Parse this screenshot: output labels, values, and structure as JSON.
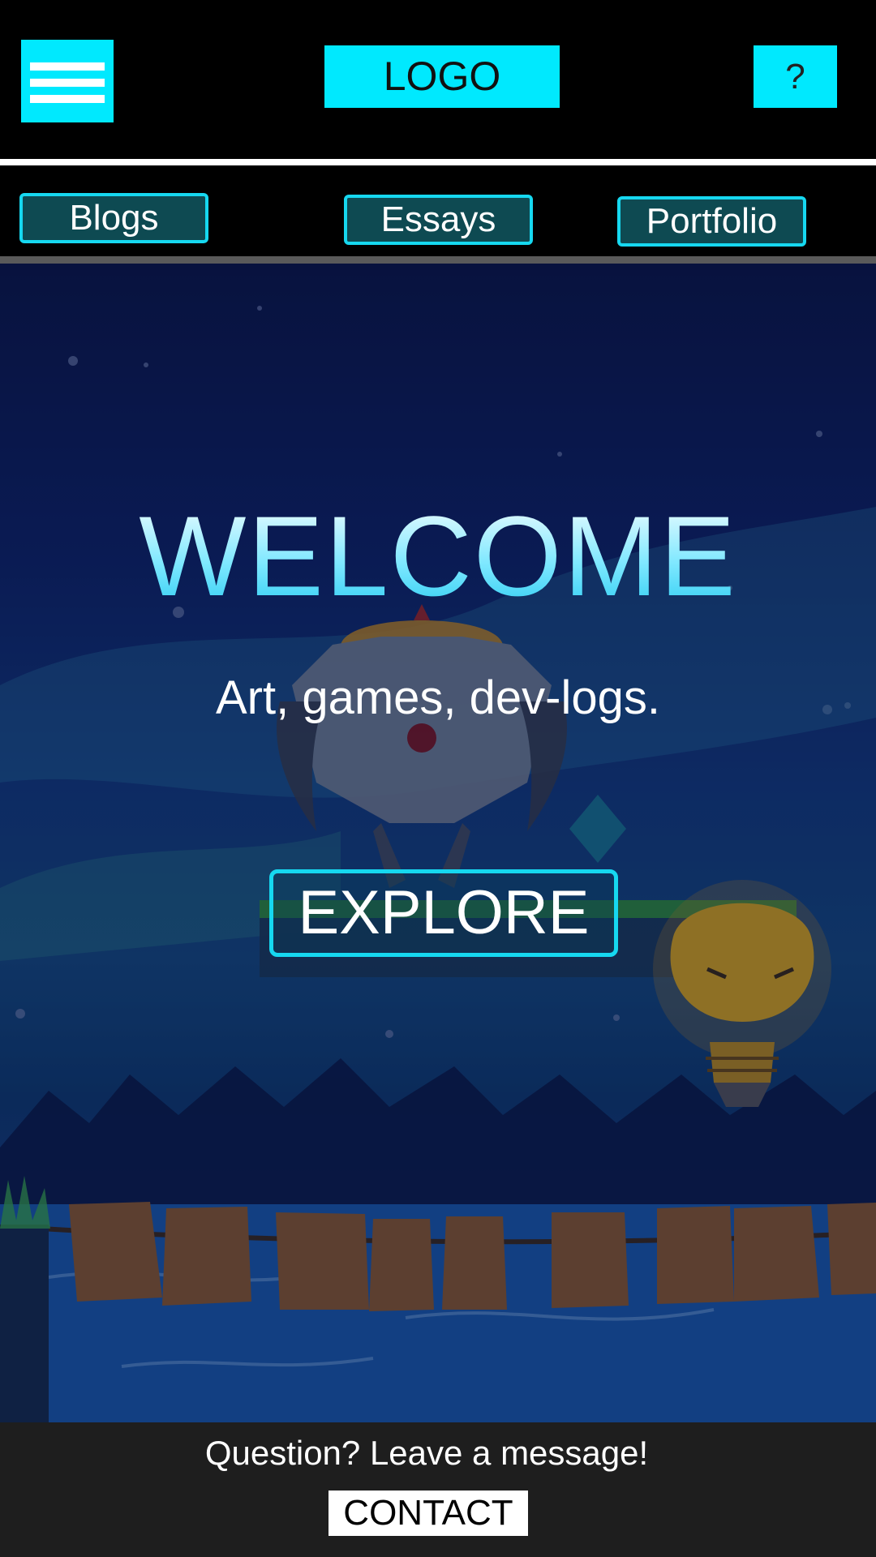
{
  "header": {
    "menu_icon": "hamburger-menu-icon",
    "logo_text": "LOGO",
    "help_label": "?"
  },
  "nav": {
    "items": [
      {
        "label": "Blogs"
      },
      {
        "label": "Essays"
      },
      {
        "label": "Portfolio"
      }
    ]
  },
  "hero": {
    "title": "WELCOME",
    "tagline": "Art, games, dev-logs.",
    "cta_label": "EXPLORE"
  },
  "footer": {
    "message": "Question? Leave a message!",
    "contact_label": "CONTACT"
  },
  "colors": {
    "accent": "#00e9fe",
    "nav_button_fill": "#0e4a52",
    "footer_bg": "#1e1e1e"
  }
}
